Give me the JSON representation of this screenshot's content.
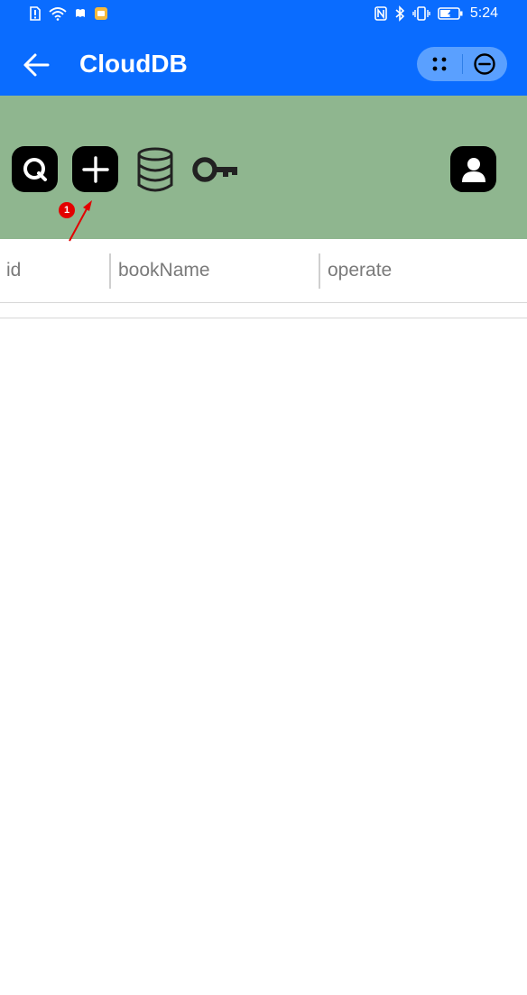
{
  "status_bar": {
    "time": "5:24",
    "icons_left": [
      "sim-alert-icon",
      "wifi-icon",
      "notification-icon",
      "app-notification-icon"
    ],
    "icons_right": [
      "nfc-icon",
      "bluetooth-icon",
      "vibrate-icon",
      "battery-charging-icon"
    ]
  },
  "header": {
    "title": "CloudDB",
    "back_icon": "arrow-left-icon",
    "capsule_icons": [
      "more-dots-icon",
      "minimize-circle-icon"
    ]
  },
  "toolbar": {
    "buttons": [
      "search-icon",
      "plus-icon",
      "database-icon",
      "key-icon",
      "user-icon"
    ],
    "annotation_badge": "1"
  },
  "table": {
    "columns": [
      "id",
      "bookName",
      "operate"
    ],
    "rows": []
  },
  "colors": {
    "header_blue": "#0a6cff",
    "toolbar_green": "#8fb68f",
    "badge_red": "#e30000"
  }
}
